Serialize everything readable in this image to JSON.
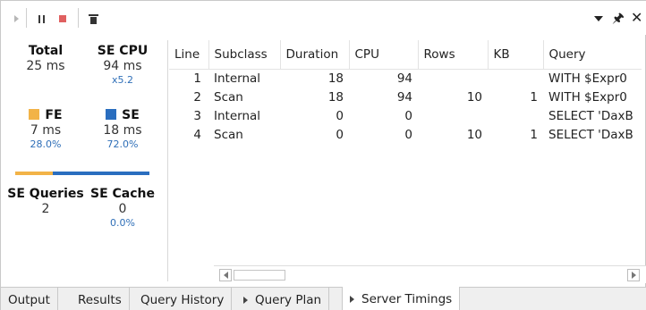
{
  "toolbar": {
    "icons": [
      "play-icon",
      "pause-icon",
      "stop-icon",
      "delete-icon"
    ],
    "window_controls": {
      "pin": "ρ",
      "close": "×"
    }
  },
  "summary": {
    "total": {
      "label": "Total",
      "value": "25 ms"
    },
    "se_cpu": {
      "label": "SE CPU",
      "value": "94 ms",
      "sub": "x5.2"
    },
    "fe": {
      "label": "FE",
      "value": "7 ms",
      "sub": "28.0%",
      "color": "#f2b347",
      "fraction": 0.28
    },
    "se": {
      "label": "SE",
      "value": "18 ms",
      "sub": "72.0%",
      "color": "#2a6ebf",
      "fraction": 0.72
    },
    "se_queries": {
      "label": "SE Queries",
      "value": "2"
    },
    "se_cache": {
      "label": "SE Cache",
      "value": "0",
      "sub": "0.0%"
    }
  },
  "table": {
    "columns": [
      "Line",
      "Subclass",
      "Duration",
      "CPU",
      "Rows",
      "KB",
      "Query"
    ],
    "rows": [
      [
        "1",
        "Internal",
        "18",
        "94",
        "",
        "",
        "WITH $Expr0"
      ],
      [
        "2",
        "Scan",
        "18",
        "94",
        "10",
        "1",
        "WITH $Expr0"
      ],
      [
        "3",
        "Internal",
        "0",
        "0",
        "",
        "",
        "SELECT 'DaxB"
      ],
      [
        "4",
        "Scan",
        "0",
        "0",
        "10",
        "1",
        "SELECT 'DaxB"
      ]
    ]
  },
  "tabs": [
    {
      "label": "Output",
      "active": false,
      "arrow": false
    },
    {
      "label": "Results",
      "active": false,
      "arrow": false
    },
    {
      "label": "Query History",
      "active": false,
      "arrow": false
    },
    {
      "label": "Query Plan",
      "active": false,
      "arrow": true
    },
    {
      "label": "Server Timings",
      "active": true,
      "arrow": true
    }
  ]
}
